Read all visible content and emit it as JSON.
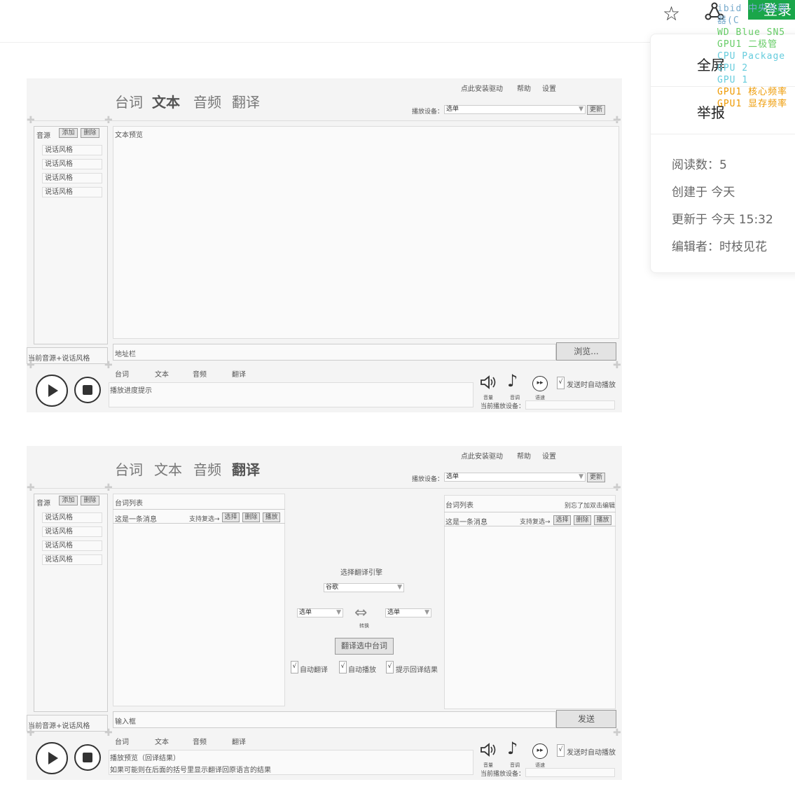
{
  "topbar": {
    "star_icon": "star-icon",
    "share_icon": "share-icon",
    "login_label": "登录"
  },
  "card": {
    "fullscreen": "全屏",
    "report": "举报",
    "read_count": "阅读数：5",
    "created": "创建于 今天",
    "updated": "更新于 今天 15:32",
    "editor": "编辑者：时枝见花"
  },
  "overlay_lines": [
    "ibid 中央处理器(C",
    "WD Blue SN5",
    "GPU1 二极管",
    "CPU Package",
    "GPU 2",
    "GPU 1",
    "GPU1 核心频率",
    "GPU1 显存频率"
  ],
  "panel1": {
    "tabs": [
      "台词",
      "文本",
      "音频",
      "翻译"
    ],
    "active_tab": "文本",
    "menu": [
      "点此安装驱动",
      "帮助",
      "设置"
    ],
    "device_label": "播放设备：",
    "device_value": "选单",
    "refresh_label": "更新",
    "source_label": "音源",
    "add_label": "添加",
    "delete_label": "删除",
    "styles": [
      "说话风格",
      "说话风格",
      "说话风格",
      "说话风格"
    ],
    "preview_label": "文本预览",
    "current_label": "当前音源+说话风格",
    "address_label": "地址栏",
    "browse_label": "浏览...",
    "bottom_tabs": [
      "台词",
      "文本",
      "音频",
      "翻译"
    ],
    "progress_label": "播放进度提示",
    "auto_play": "发送时自动播放",
    "volume": "音量",
    "pitch": "音调",
    "speed": "语速",
    "play_device": "当前播放设备："
  },
  "panel2": {
    "tabs": [
      "台词",
      "文本",
      "音频",
      "翻译"
    ],
    "active_tab": "翻译",
    "menu": [
      "点此安装驱动",
      "帮助",
      "设置"
    ],
    "device_label": "播放设备：",
    "device_value": "选单",
    "refresh_label": "更新",
    "source_label": "音源",
    "add_label": "添加",
    "delete_label": "删除",
    "styles": [
      "说话风格",
      "说话风格",
      "说话风格",
      "说话风格"
    ],
    "left_list_label": "台词列表",
    "right_list_label": "台词列表",
    "dbl_hint": "别忘了加双击编辑",
    "message": "这是一条消息",
    "multi": "支持复选→",
    "select_btn": "选择",
    "delete_btn": "删除",
    "play_btn": "播放",
    "engine_label": "选择翻译引擎",
    "engine_value": "谷歌",
    "lang_from": "选单",
    "lang_to": "选单",
    "swap_label": "转换",
    "translate_btn": "翻译选中台词",
    "auto_translate": "自动翻译",
    "auto_play": "自动播放",
    "show_back": "提示回译结果",
    "current_label": "当前音源+说话风格",
    "input_label": "输入框",
    "send_label": "发送",
    "bottom_tabs": [
      "台词",
      "文本",
      "音频",
      "翻译"
    ],
    "preview_line1": "播放预览（回译结果）",
    "preview_line2": "如果可能则在后面的括号里显示翻译回原语言的结果",
    "auto_play_send": "发送时自动播放",
    "volume": "音量",
    "pitch": "音调",
    "speed": "语速",
    "play_device": "当前播放设备：",
    "check_mark": "√"
  }
}
